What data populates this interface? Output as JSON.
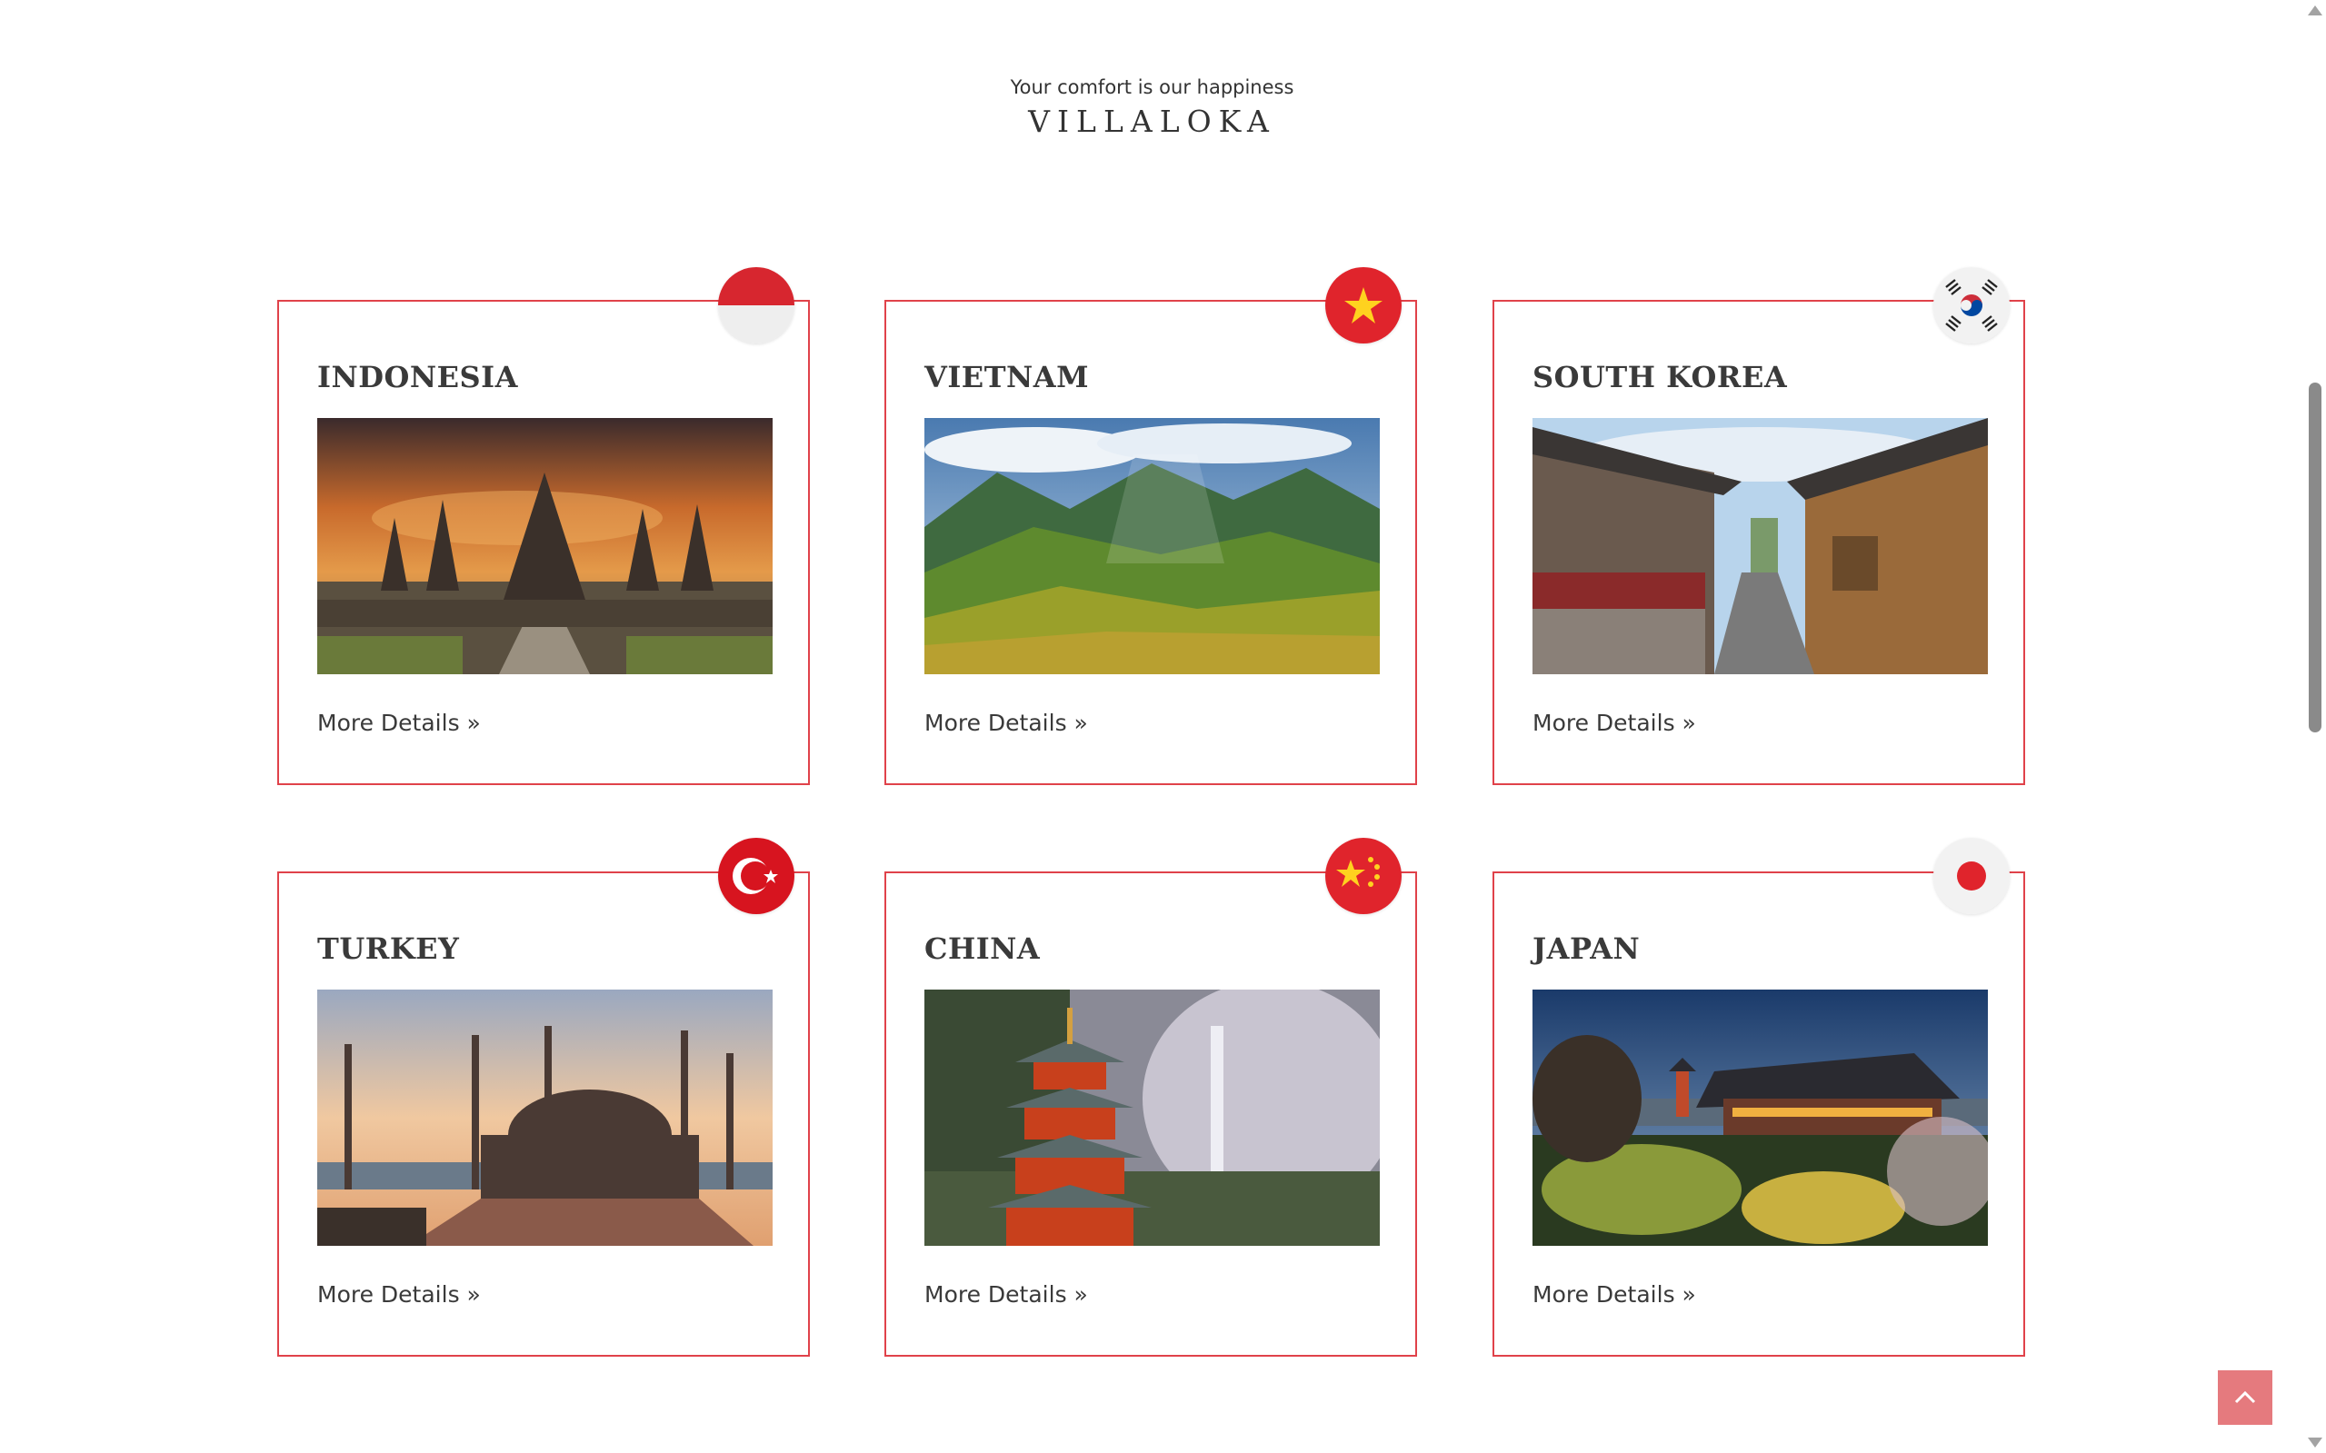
{
  "header": {
    "tagline": "Your comfort is our happiness",
    "brand": "VILLALOKA"
  },
  "theme": {
    "accent": "#e0424a",
    "back_to_top_bg": "#e57a7e",
    "text": "#333333"
  },
  "destinations": [
    {
      "name": "INDONESIA",
      "link": "More Details »",
      "flag_icon": "indonesia-flag-icon",
      "image": "prambanan-temple-sunset"
    },
    {
      "name": "VIETNAM",
      "link": "More Details »",
      "flag_icon": "vietnam-flag-icon",
      "image": "rice-terrace-valley"
    },
    {
      "name": "SOUTH KOREA",
      "link": "More Details »",
      "flag_icon": "south-korea-flag-icon",
      "image": "hanok-village-street"
    },
    {
      "name": "TURKEY",
      "link": "More Details »",
      "flag_icon": "turkey-flag-icon",
      "image": "blue-mosque-sunset"
    },
    {
      "name": "CHINA",
      "link": "More Details »",
      "flag_icon": "china-flag-icon",
      "image": "pagoda-waterfall"
    },
    {
      "name": "JAPAN",
      "link": "More Details »",
      "flag_icon": "japan-flag-icon",
      "image": "kiyomizu-temple-night"
    }
  ],
  "controls": {
    "back_to_top_icon": "chevron-up-icon",
    "scroll_up_icon": "scroll-up-arrow-icon",
    "scroll_down_icon": "scroll-down-arrow-icon"
  }
}
